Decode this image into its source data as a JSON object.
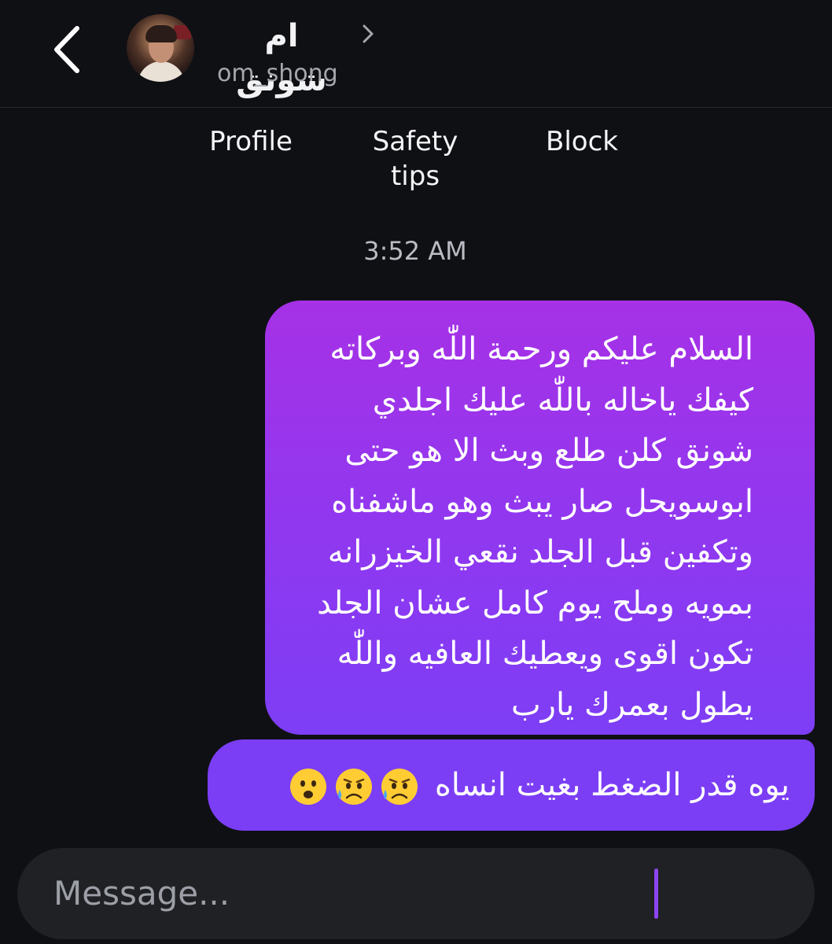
{
  "header": {
    "back_icon": "chevron-left-icon",
    "contact_name": "ام شونق",
    "username": "om_shong",
    "name_chevron_icon": "chevron-right-icon"
  },
  "actions": {
    "profile": "Profile",
    "safety_line1": "Safety",
    "safety_line2": "tips",
    "block": "Block"
  },
  "timestamp": "3:52 AM",
  "messages": {
    "first_lines": [
      "السلام عليكم ورحمة اللّٰه وبركاته",
      "كيفك ياخاله باللّٰه عليك اجلدي",
      "شونق كلن طلع وبث الا هو حتى",
      "ابوسويحل صار يبث وهو ماشفناه",
      "وتكفين قبل الجلد نقعي الخيزرانه",
      "بمويه وملح يوم كامل عشان الجلد",
      "تكون اقوى ويعطيك العافيه واللّٰه",
      "يطول بعمرك يارب"
    ],
    "second_text": "يوه قدر الضغط بغيت انساه",
    "second_emojis": [
      "sad-relieved-face-icon",
      "sad-relieved-face-icon",
      "frowning-open-mouth-face-icon"
    ]
  },
  "composer": {
    "placeholder": "Message..."
  },
  "colors": {
    "background": "#0f1014",
    "bubble_gradient_top": "#a631e6",
    "bubble_gradient_bottom": "#7d3ef5",
    "caret": "#8d45f0"
  }
}
